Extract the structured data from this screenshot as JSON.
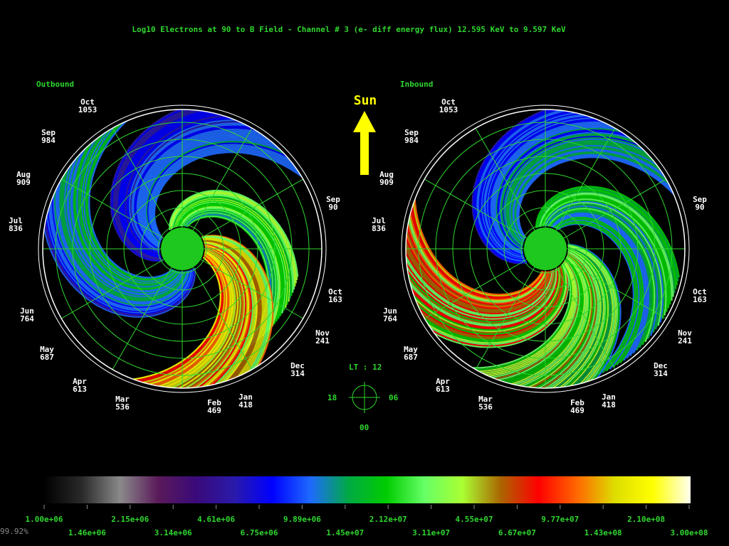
{
  "title": "Log10 Electrons at 90 to B Field - Channel # 3 (e- diff energy flux) 12.595 KeV to  9.597 KeV",
  "sun_label": "Sun",
  "lt_label": "LT :  12",
  "lt_dial": {
    "left": "18",
    "right": "06",
    "bottom": "00"
  },
  "corner_note": "99.92%",
  "colors": {
    "text": "#2fd62f",
    "grid": "#2fd62f",
    "planet": "#1ec81e",
    "sun_arrow": "#ffff00"
  },
  "chart_data": [
    {
      "type": "heatmap",
      "title": "Outbound",
      "date_labels": [
        {
          "month": "Oct",
          "day": "1053"
        },
        {
          "month": "Sep",
          "day": "984"
        },
        {
          "month": "Aug",
          "day": "909"
        },
        {
          "month": "Jul",
          "day": "836"
        },
        {
          "month": "Jun",
          "day": "764"
        },
        {
          "month": "May",
          "day": "687"
        },
        {
          "month": "Apr",
          "day": "613"
        },
        {
          "month": "Mar",
          "day": "536"
        },
        {
          "month": "Feb",
          "day": "469"
        },
        {
          "month": "Jan",
          "day": "418"
        },
        {
          "month": "Dec",
          "day": "314"
        },
        {
          "month": "Nov",
          "day": "241"
        },
        {
          "month": "Oct",
          "day": "163"
        },
        {
          "month": "Sep",
          "day": "90"
        }
      ]
    },
    {
      "type": "heatmap",
      "title": "Inbound",
      "date_labels": [
        {
          "month": "Oct",
          "day": "1053"
        },
        {
          "month": "Sep",
          "day": "984"
        },
        {
          "month": "Aug",
          "day": "909"
        },
        {
          "month": "Jul",
          "day": "836"
        },
        {
          "month": "Jun",
          "day": "764"
        },
        {
          "month": "May",
          "day": "687"
        },
        {
          "month": "Apr",
          "day": "613"
        },
        {
          "month": "Mar",
          "day": "536"
        },
        {
          "month": "Feb",
          "day": "469"
        },
        {
          "month": "Jan",
          "day": "418"
        },
        {
          "month": "Dec",
          "day": "314"
        },
        {
          "month": "Nov",
          "day": "241"
        },
        {
          "month": "Oct",
          "day": "163"
        },
        {
          "month": "Sep",
          "day": "90"
        }
      ]
    }
  ],
  "colorbar": {
    "stops": [
      "#000000",
      "#2a2a2a",
      "#8a8a8a",
      "#5a1a5a",
      "#3a0a7a",
      "#2a1aaa",
      "#0000ff",
      "#1e6aff",
      "#00aa44",
      "#00cc00",
      "#66ff66",
      "#aaff33",
      "#aa6600",
      "#ff0000",
      "#ff6600",
      "#dddd00",
      "#ffff00",
      "#ffffee"
    ],
    "tick_labels_top": [
      "1.00e+06",
      "2.15e+06",
      "4.61e+06",
      "9.89e+06",
      "2.12e+07",
      "4.55e+07",
      "9.77e+07",
      "2.10e+08"
    ],
    "tick_labels_bottom": [
      "1.46e+06",
      "3.14e+06",
      "6.75e+06",
      "1.45e+07",
      "3.11e+07",
      "6.67e+07",
      "1.43e+08",
      "3.00e+08"
    ]
  }
}
